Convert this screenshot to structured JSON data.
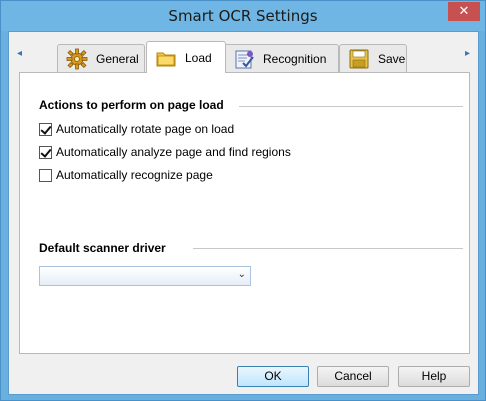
{
  "window": {
    "title": "Smart OCR Settings",
    "close_glyph": "✕"
  },
  "tabs": [
    {
      "label": "General",
      "icon": "gear-icon",
      "selected": false
    },
    {
      "label": "Load",
      "icon": "folder-icon",
      "selected": true
    },
    {
      "label": "Recognition",
      "icon": "recognition-icon",
      "selected": false
    },
    {
      "label": "Save",
      "icon": "floppy-disk-icon",
      "selected": false
    }
  ],
  "tab_scroll": {
    "left_glyph": "◂",
    "right_glyph": "▸"
  },
  "load_panel": {
    "actions_title": "Actions to perform on page load",
    "options": [
      {
        "label": "Automatically rotate page on load",
        "checked": true
      },
      {
        "label": "Automatically analyze page and find regions",
        "checked": true
      },
      {
        "label": "Automatically recognize page",
        "checked": false
      }
    ],
    "scanner_title": "Default scanner driver",
    "scanner_value": "",
    "dropdown_glyph": "⌄"
  },
  "buttons": {
    "ok": "OK",
    "cancel": "Cancel",
    "help": "Help"
  },
  "colors": {
    "title_bar": "#6fb6e4",
    "close_button": "#c75050",
    "accent": "#3c7fb1"
  }
}
